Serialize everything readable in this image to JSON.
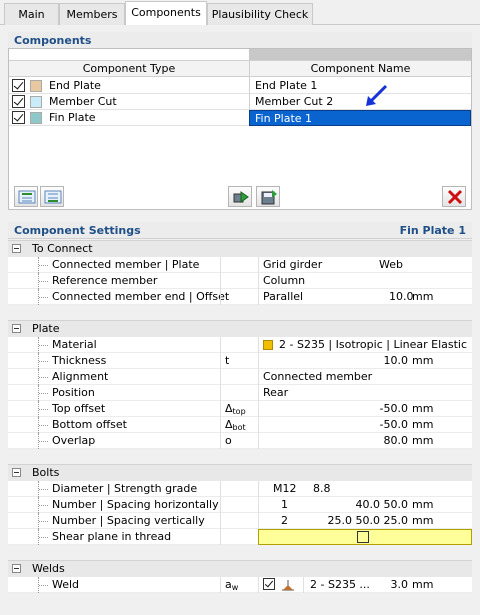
{
  "tabs": [
    "Main",
    "Members",
    "Components",
    "Plausibility Check"
  ],
  "components": {
    "title": "Components",
    "col_type": "Component Type",
    "col_name": "Component Name",
    "rows": [
      {
        "type": "End Plate",
        "name": "End Plate 1",
        "color": "#e8c8a0"
      },
      {
        "type": "Member Cut",
        "name": "Member Cut 2",
        "color": "#c8ecf8"
      },
      {
        "type": "Fin Plate",
        "name": "Fin Plate 1",
        "color": "#8fc8c8"
      }
    ]
  },
  "settings": {
    "title": "Component Settings",
    "selected": "Fin Plate 1",
    "to_connect": {
      "group": "To Connect",
      "r1": {
        "label": "Connected member | Plate",
        "v1": "Grid girder",
        "v2": "Web"
      },
      "r2": {
        "label": "Reference member",
        "v1": "Column"
      },
      "r3": {
        "label": "Connected member end | Offset",
        "v1": "Parallel",
        "v2": "10.0",
        "unit": "mm"
      }
    },
    "plate": {
      "group": "Plate",
      "material": {
        "label": "Material",
        "value": "2 - S235 | Isotropic | Linear Elastic",
        "color": "#f0c000"
      },
      "thickness": {
        "label": "Thickness",
        "sym": "t",
        "value": "10.0",
        "unit": "mm"
      },
      "alignment": {
        "label": "Alignment",
        "value": "Connected member"
      },
      "position": {
        "label": "Position",
        "value": "Rear"
      },
      "top_offset": {
        "label": "Top offset",
        "sym": "Δ",
        "sub": "top",
        "value": "-50.0",
        "unit": "mm"
      },
      "bottom_offset": {
        "label": "Bottom offset",
        "sym": "Δ",
        "sub": "bot",
        "value": "-50.0",
        "unit": "mm"
      },
      "overlap": {
        "label": "Overlap",
        "sym": "o",
        "value": "80.0",
        "unit": "mm"
      }
    },
    "bolts": {
      "group": "Bolts",
      "diameter": {
        "label": "Diameter | Strength grade",
        "v1": "M12",
        "v2": "8.8"
      },
      "horiz": {
        "label": "Number | Spacing horizontally",
        "v1": "1",
        "v2": "40.0 50.0",
        "unit": "mm"
      },
      "vert": {
        "label": "Number | Spacing vertically",
        "v1": "2",
        "v2": "25.0 50.0 25.0",
        "unit": "mm"
      },
      "shear": {
        "label": "Shear plane in thread"
      }
    },
    "welds": {
      "group": "Welds",
      "weld": {
        "label": "Weld",
        "sym": "a",
        "sub": "w",
        "value": "2 - S235 ...",
        "size": "3.0",
        "unit": "mm"
      }
    }
  }
}
